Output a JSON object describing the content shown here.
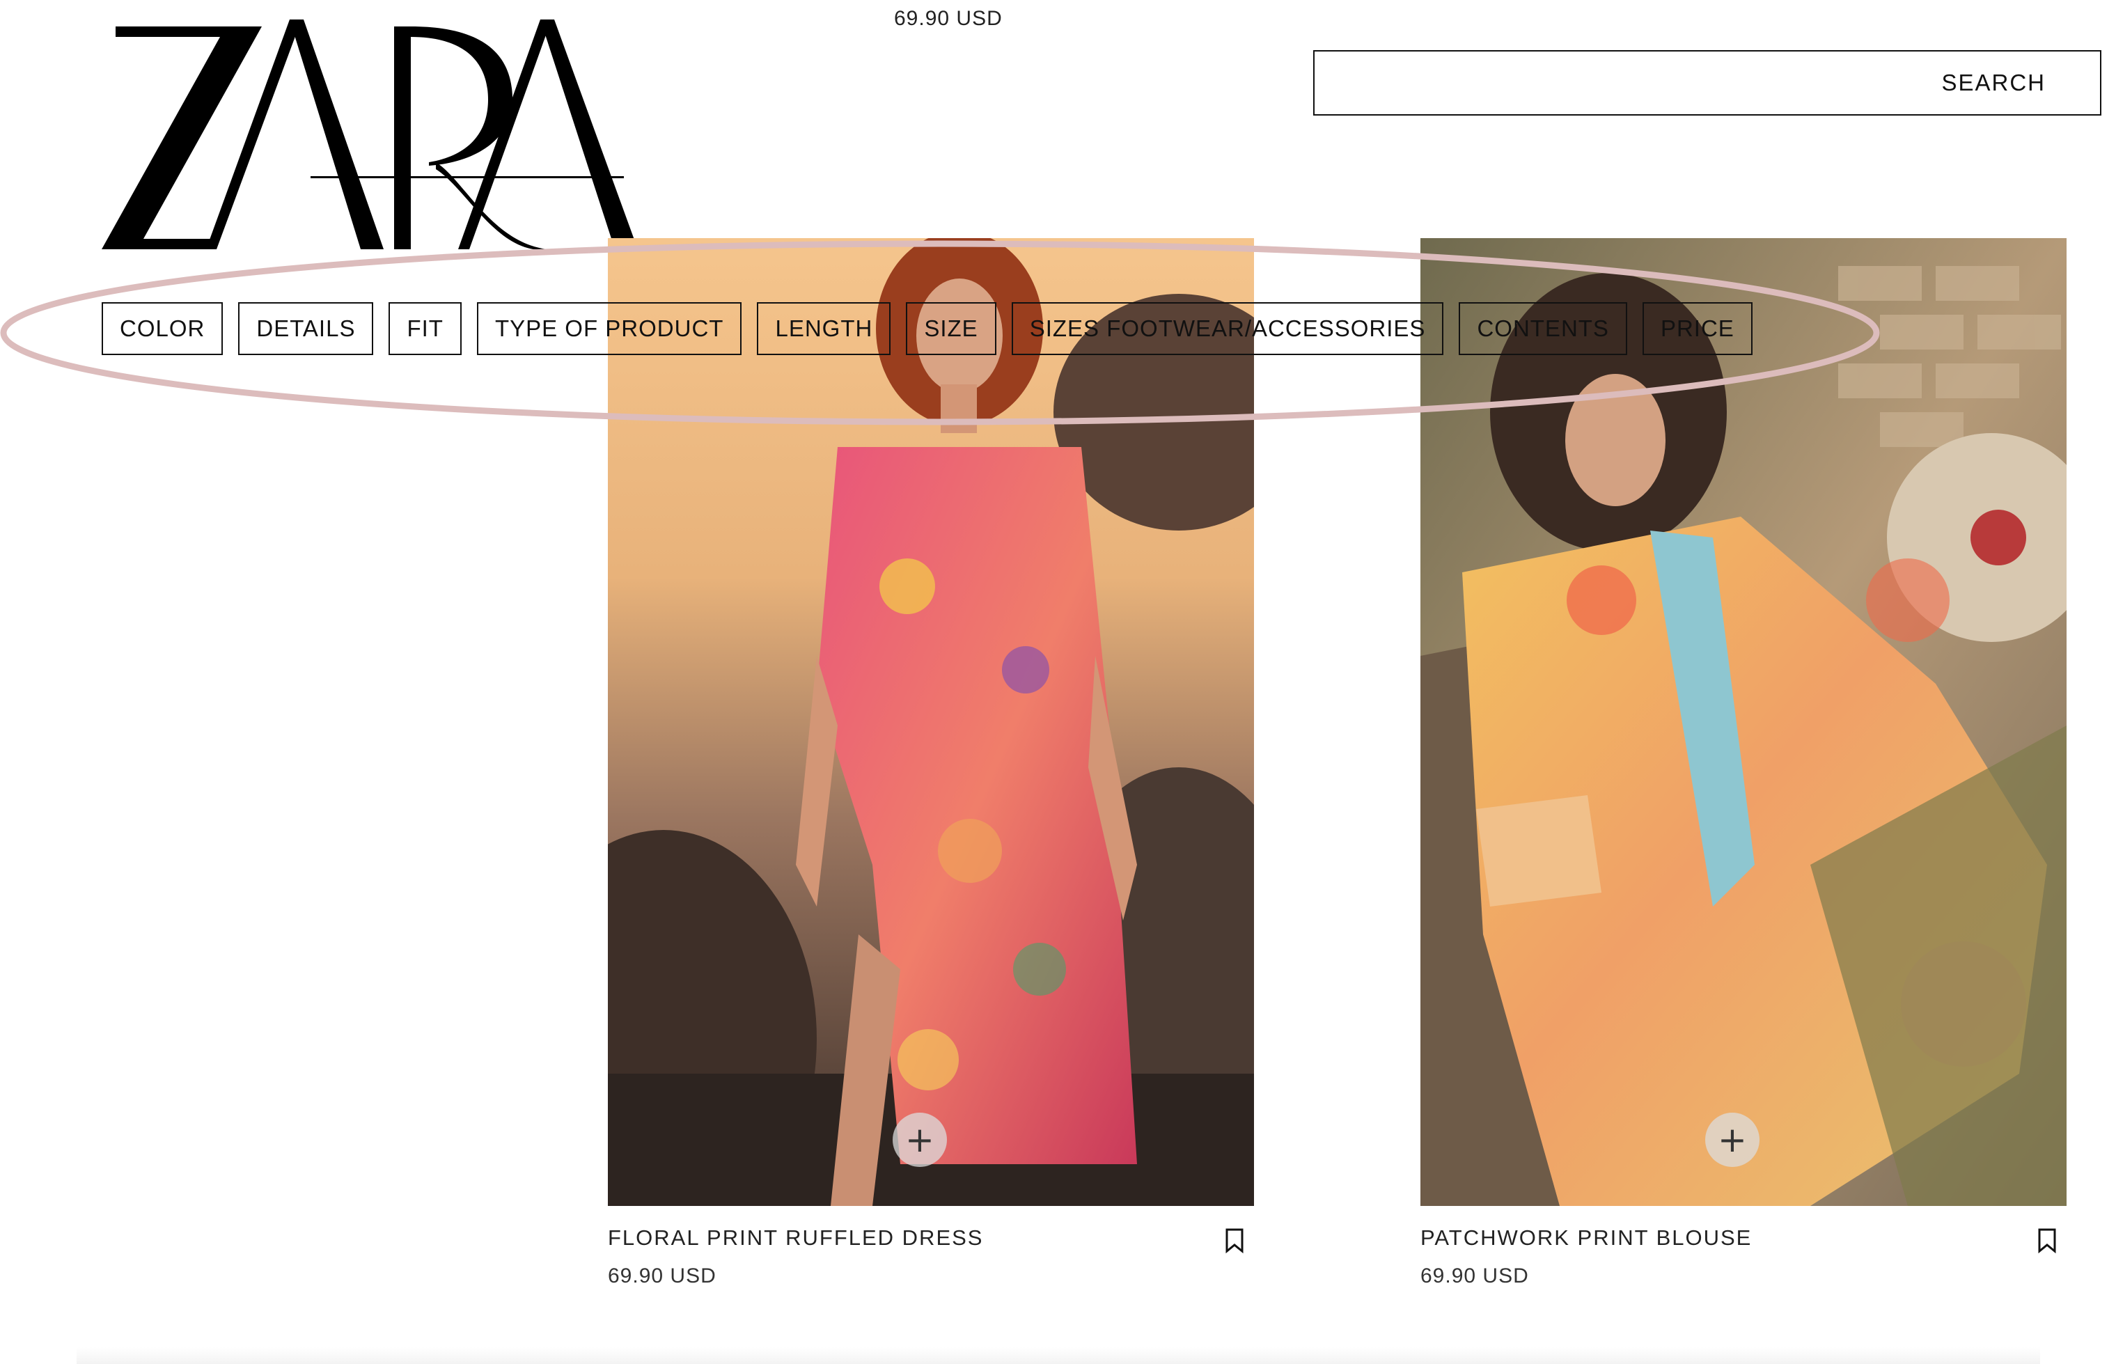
{
  "header": {
    "brand": "ZARA",
    "top_price": "69.90 USD",
    "search_label": "SEARCH"
  },
  "filters": [
    "COLOR",
    "DETAILS",
    "FIT",
    "TYPE OF PRODUCT",
    "LENGTH",
    "SIZE",
    "SIZES FOOTWEAR/ACCESSORIES",
    "CONTENTS",
    "PRICE"
  ],
  "products": [
    {
      "name": "FLORAL PRINT RUFFLED DRESS",
      "price": "69.90 USD",
      "add_icon": "plus-icon",
      "save_icon": "bookmark-icon"
    },
    {
      "name": "PATCHWORK PRINT BLOUSE",
      "price": "69.90 USD",
      "add_icon": "plus-icon",
      "save_icon": "bookmark-icon"
    }
  ],
  "annotation": {
    "shape": "ellipse",
    "color": "#dcbcbc"
  }
}
